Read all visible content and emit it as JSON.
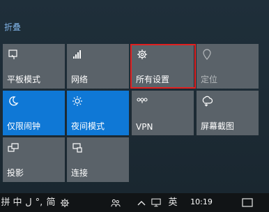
{
  "action_center": {
    "collapse_label": "折叠",
    "tiles": [
      {
        "label": "平板模式",
        "icon": "tablet-mode-icon",
        "state": "off"
      },
      {
        "label": "网络",
        "icon": "network-icon",
        "state": "off"
      },
      {
        "label": "所有设置",
        "icon": "settings-gear-icon",
        "state": "off"
      },
      {
        "label": "定位",
        "icon": "location-icon",
        "state": "disabled"
      },
      {
        "label": "仅限闹钟",
        "icon": "moon-icon",
        "state": "on"
      },
      {
        "label": "夜间模式",
        "icon": "brightness-icon",
        "state": "on"
      },
      {
        "label": "VPN",
        "icon": "vpn-icon",
        "state": "off"
      },
      {
        "label": "屏幕截图",
        "icon": "screen-snip-icon",
        "state": "off"
      },
      {
        "label": "投影",
        "icon": "project-icon",
        "state": "off"
      },
      {
        "label": "连接",
        "icon": "connect-icon",
        "state": "off"
      }
    ],
    "highlight_color": "#e02020",
    "accent_color": "#0f78d6"
  },
  "taskbar": {
    "ime_glyphs": [
      "拼",
      "中",
      "ل",
      "°,",
      "简"
    ],
    "english_indicator": "英",
    "time": "10:19"
  }
}
